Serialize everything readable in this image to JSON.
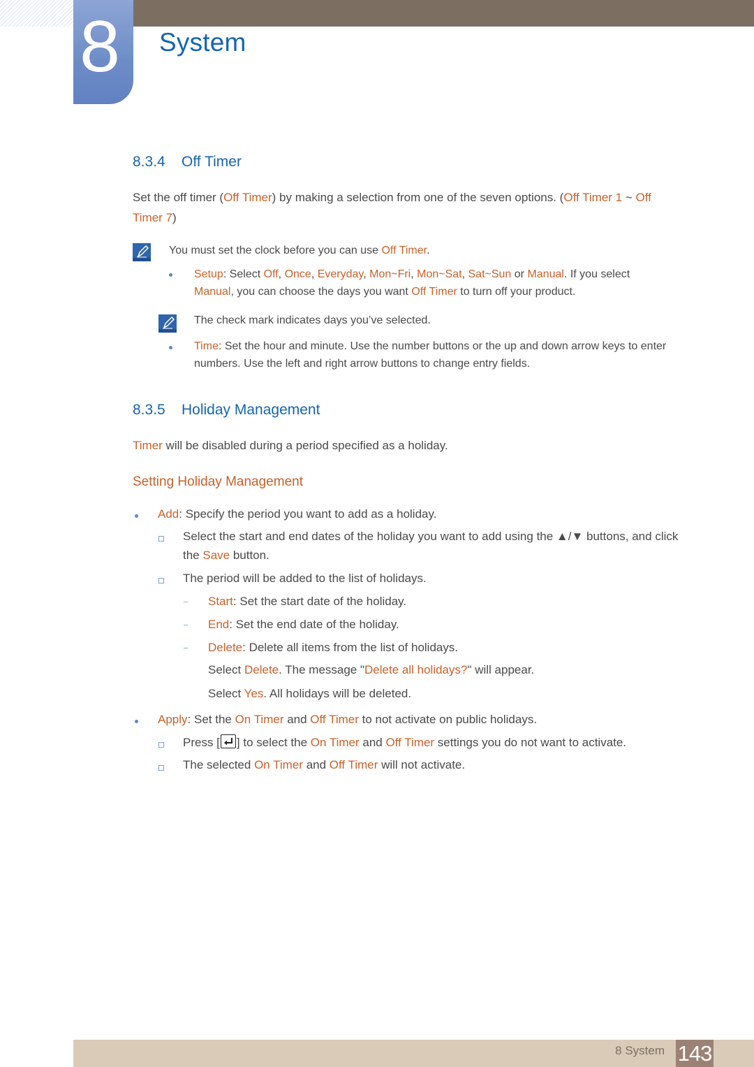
{
  "chapter": {
    "number": "8",
    "title": "System"
  },
  "section_834": {
    "number": "8.3.4",
    "title": "Off Timer",
    "intro": {
      "t1": "Set the off timer (",
      "e1": "Off Timer",
      "t2": ") by making a selection from one of the seven options. (",
      "e2": "Off Timer 1",
      "t3": " ~ ",
      "e3": "Off",
      "e4": "Timer 7",
      "t4": ")"
    },
    "note1": {
      "icon": "note-pencil-icon",
      "t1": "You must set the clock before you can use ",
      "e1": "Off Timer",
      "t2": "."
    },
    "setup": {
      "e_label": "Setup",
      "t1": ": Select ",
      "options": [
        "Off",
        "Once",
        "Everyday",
        "Mon~Fri",
        "Mon~Sat",
        "Sat~Sun"
      ],
      "sep": ", ",
      "t_or": " or ",
      "e_manual": "Manual",
      "t2": ". If you select",
      "e_manual2": "Manual",
      "t3": ", you can choose the days you want ",
      "e_off": "Off Timer",
      "t4": " to turn off your product."
    },
    "note2": {
      "icon": "note-pencil-icon",
      "text": "The check mark indicates days you’ve selected."
    },
    "time": {
      "e_label": "Time",
      "t1": ": Set the hour and minute. Use the number buttons or the up and down arrow keys to enter",
      "t2": "numbers. Use the left and right arrow buttons to change entry fields."
    }
  },
  "section_835": {
    "number": "8.3.5",
    "title": "Holiday Management",
    "intro": {
      "e1": "Timer",
      "t1": " will be disabled during a period specified as a holiday."
    },
    "subheading": "Setting Holiday Management",
    "add": {
      "e_label": "Add",
      "t1": ": Specify the period you want to add as a holiday.",
      "sub1": {
        "t1": "Select the start and end dates of the holiday you want to add using the ▲/▼ buttons, and click",
        "t2": "the ",
        "e1": "Save",
        "t3": " button."
      },
      "sub2": "The period will be added to the list of holidays.",
      "start": {
        "e": "Start",
        "t": ": Set the start date of the holiday."
      },
      "end": {
        "e": "End",
        "t": ": Set the end date of the holiday."
      },
      "delete": {
        "e": "Delete",
        "t": ": Delete all items from the list of holidays."
      },
      "delete_msg": {
        "t1": "Select ",
        "e1": "Delete",
        "t2": ". The message \"",
        "e2": "Delete all holidays?",
        "t3": "\" will appear."
      },
      "yes_msg": {
        "t1": "Select ",
        "e1": "Yes",
        "t2": ". All holidays will be deleted."
      }
    },
    "apply": {
      "e_label": "Apply",
      "t1": ": Set the ",
      "e_on": "On Timer",
      "t2": " and ",
      "e_off": "Off Timer",
      "t3": " to not activate on public holidays.",
      "sub1": {
        "t1": "Press [",
        "key_icon": "enter-key-icon",
        "t2": "] to select the ",
        "e_on": "On Timer",
        "t3": " and ",
        "e_off": "Off Timer",
        "t4": " settings you do not want to activate."
      },
      "sub2": {
        "t1": "The selected ",
        "e_on": "On Timer",
        "t2": " and ",
        "e_off": "Off Timer",
        "t3": " will not activate."
      }
    }
  },
  "footer": {
    "label": "8 System",
    "page": "143"
  },
  "colors": {
    "heading_blue": "#1565b0",
    "emphasis_orange": "#c7622a",
    "body_text": "#4a4a4a",
    "top_bar": "#7d6e62",
    "footer_bar": "#d9cbb8",
    "page_badge": "#9b8275"
  }
}
